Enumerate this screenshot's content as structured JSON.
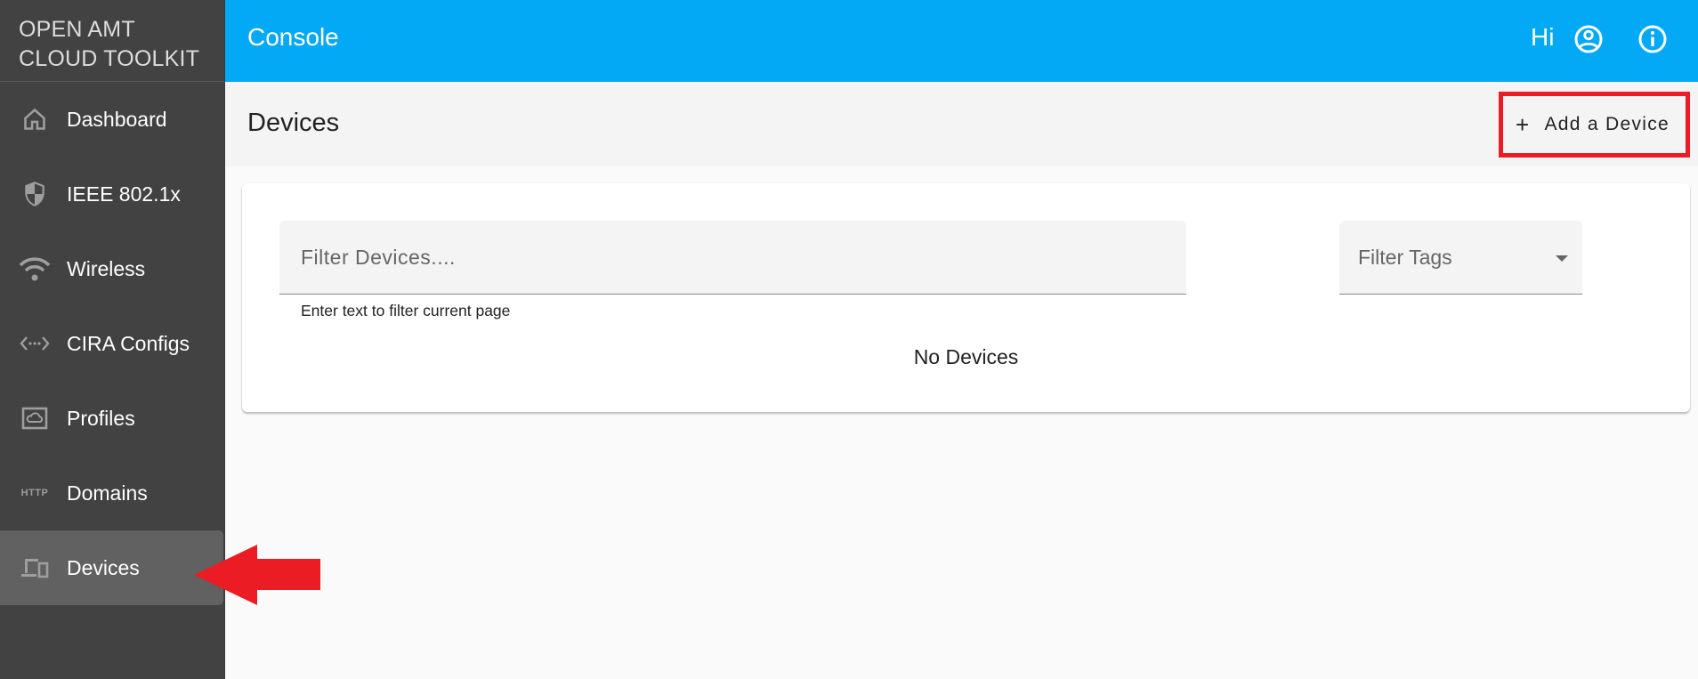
{
  "brand": {
    "line1": "OPEN AMT",
    "line2": "CLOUD TOOLKIT"
  },
  "sidebar": {
    "items": [
      {
        "label": "Dashboard",
        "icon": "home-icon",
        "active": false
      },
      {
        "label": "IEEE 802.1x",
        "icon": "shield-icon",
        "active": false
      },
      {
        "label": "Wireless",
        "icon": "wifi-icon",
        "active": false
      },
      {
        "label": "CIRA Configs",
        "icon": "code-arrows-icon",
        "active": false
      },
      {
        "label": "Profiles",
        "icon": "cloud-box-icon",
        "active": false
      },
      {
        "label": "Domains",
        "icon": "http-icon",
        "icon_text": "HTTP",
        "active": false
      },
      {
        "label": "Devices",
        "icon": "devices-icon",
        "active": true
      }
    ]
  },
  "topbar": {
    "title": "Console",
    "greeting": "Hi",
    "user_icon": "account-circle-icon",
    "info_icon": "info-icon"
  },
  "page": {
    "title": "Devices",
    "add_button": {
      "plus": "+",
      "label": "Add a Device"
    }
  },
  "filters": {
    "devices": {
      "placeholder": "Filter Devices....",
      "value": "",
      "hint": "Enter text to filter current page"
    },
    "tags": {
      "label": "Filter Tags",
      "selected": ""
    }
  },
  "table": {
    "empty_message": "No Devices"
  },
  "annotations": {
    "highlight_color": "#ec1c24"
  },
  "colors": {
    "accent": "#03a9f4",
    "sidebar": "#424242",
    "sidebar_active": "#616161"
  }
}
